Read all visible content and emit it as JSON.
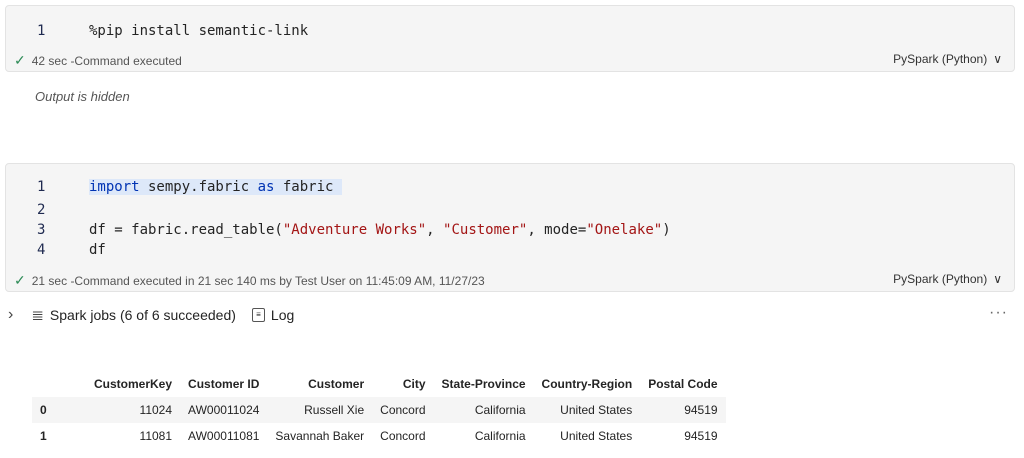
{
  "cell1": {
    "line_numbers": [
      "1"
    ],
    "code": "%pip install semantic-link",
    "status_time": "42 sec",
    "status_text": "-Command executed",
    "language": "PySpark (Python)"
  },
  "output_hidden": "Output is hidden",
  "cell2": {
    "line_numbers": [
      "1",
      "2",
      "3",
      "4"
    ],
    "line1": {
      "kw1": "import",
      "mid": " sempy.fabric ",
      "kw2": "as",
      "end": " fabric "
    },
    "line3": {
      "pre": "df = fabric.read_table(",
      "s1": "\"Adventure Works\"",
      "c1": ", ",
      "s2": "\"Customer\"",
      "c2": ", mode=",
      "s3": "\"Onelake\"",
      "post": ")"
    },
    "line4": "df",
    "status_time": "21 sec",
    "status_text": "-Command executed in 21 sec 140 ms by Test User on 11:45:09 AM, 11/27/23",
    "language": "PySpark (Python)"
  },
  "jobs": {
    "label": "Spark jobs (6 of 6 succeeded)",
    "log_label": "Log"
  },
  "more_label": "···",
  "table": {
    "headers": [
      "",
      "CustomerKey",
      "Customer ID",
      "Customer",
      "City",
      "State-Province",
      "Country-Region",
      "Postal Code"
    ],
    "rows": [
      [
        "0",
        "11024",
        "AW00011024",
        "Russell Xie",
        "Concord",
        "California",
        "United States",
        "94519"
      ],
      [
        "1",
        "11081",
        "AW00011081",
        "Savannah Baker",
        "Concord",
        "California",
        "United States",
        "94519"
      ]
    ]
  },
  "icons": {
    "check": "checkmark-icon",
    "chevron_down": "chevron-down-icon",
    "chevron_right": "chevron-right-icon",
    "jobs": "spark-jobs-icon",
    "log": "log-icon",
    "more": "more-icon"
  }
}
